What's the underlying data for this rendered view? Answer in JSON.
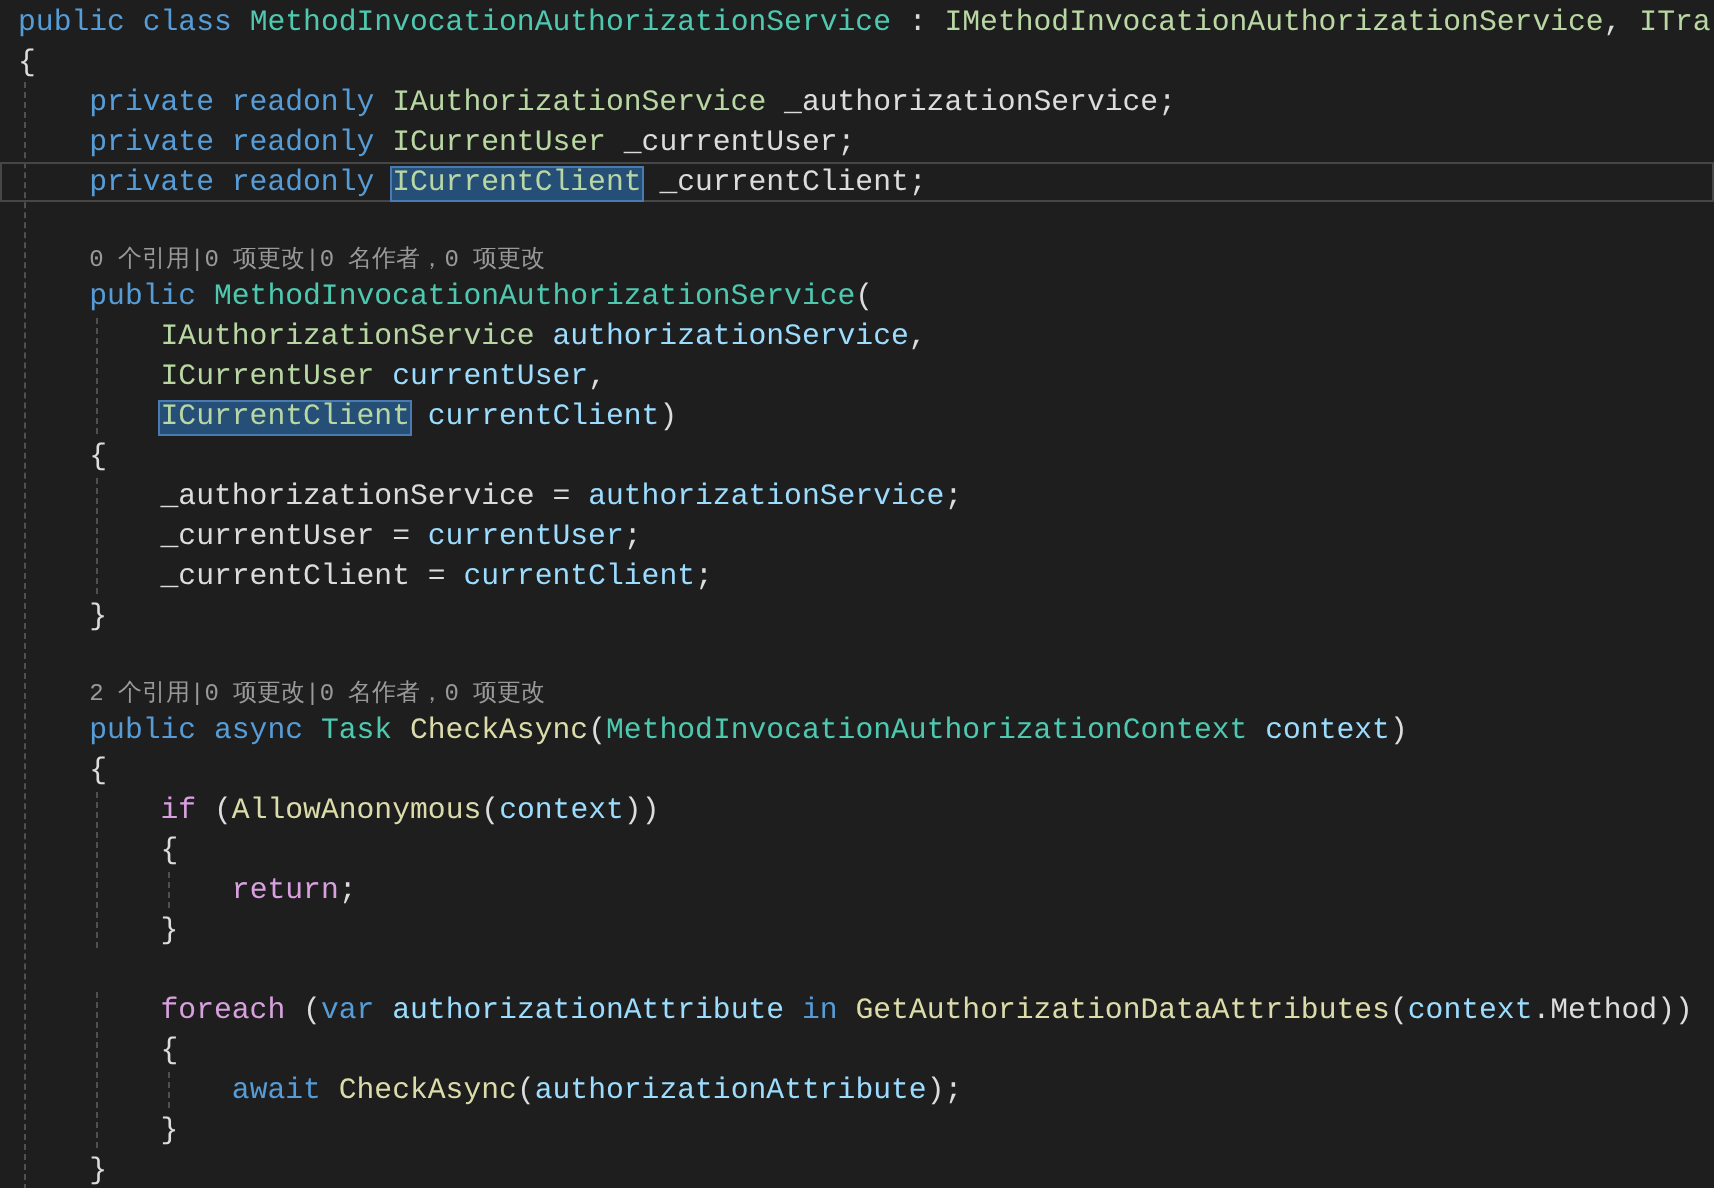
{
  "editor": {
    "lines": [
      {
        "kind": "code",
        "current": false,
        "tokens": [
          {
            "kind": "keyword",
            "text": "public class "
          },
          {
            "kind": "class",
            "text": "MethodInvocationAuthorizationService"
          },
          {
            "kind": "plain",
            "text": " : "
          },
          {
            "kind": "interface",
            "text": "IMethodInvocationAuthorizationService"
          },
          {
            "kind": "plain",
            "text": ", "
          },
          {
            "kind": "interface",
            "text": "ITra"
          }
        ]
      },
      {
        "kind": "code",
        "current": false,
        "tokens": [
          {
            "kind": "plain",
            "text": "{"
          }
        ]
      },
      {
        "kind": "code",
        "current": false,
        "tokens": [
          {
            "kind": "keyword",
            "text": "    private readonly "
          },
          {
            "kind": "interface",
            "text": "IAuthorizationService"
          },
          {
            "kind": "plain",
            "text": " _authorizationService;"
          }
        ]
      },
      {
        "kind": "code",
        "current": false,
        "tokens": [
          {
            "kind": "keyword",
            "text": "    private readonly "
          },
          {
            "kind": "interface",
            "text": "ICurrentUser"
          },
          {
            "kind": "plain",
            "text": " _currentUser;"
          }
        ]
      },
      {
        "kind": "code",
        "current": true,
        "tokens": [
          {
            "kind": "keyword",
            "text": "    private readonly "
          },
          {
            "kind": "reference",
            "text": "ICurrentClient"
          },
          {
            "kind": "plain",
            "text": " _currentClient;"
          }
        ]
      },
      {
        "kind": "blank",
        "current": false
      },
      {
        "kind": "codelens",
        "current": false,
        "text": "    0 个引用|0 项更改|0 名作者，0 项更改"
      },
      {
        "kind": "code",
        "current": false,
        "tokens": [
          {
            "kind": "keyword",
            "text": "    public "
          },
          {
            "kind": "class",
            "text": "MethodInvocationAuthorizationService"
          },
          {
            "kind": "plain",
            "text": "("
          }
        ]
      },
      {
        "kind": "code",
        "current": false,
        "tokens": [
          {
            "kind": "interface",
            "text": "        IAuthorizationService"
          },
          {
            "kind": "param",
            "text": " authorizationService"
          },
          {
            "kind": "plain",
            "text": ","
          }
        ]
      },
      {
        "kind": "code",
        "current": false,
        "tokens": [
          {
            "kind": "interface",
            "text": "        ICurrentUser"
          },
          {
            "kind": "param",
            "text": " currentUser"
          },
          {
            "kind": "plain",
            "text": ","
          }
        ]
      },
      {
        "kind": "code",
        "current": false,
        "tokens": [
          {
            "kind": "reference",
            "text": "        ICurrentClient"
          },
          {
            "kind": "param",
            "text": " currentClient"
          },
          {
            "kind": "plain",
            "text": ")"
          }
        ]
      },
      {
        "kind": "code",
        "current": false,
        "tokens": [
          {
            "kind": "plain",
            "text": "    {"
          }
        ]
      },
      {
        "kind": "code",
        "current": false,
        "tokens": [
          {
            "kind": "plain",
            "text": "        _authorizationService = "
          },
          {
            "kind": "param",
            "text": "authorizationService"
          },
          {
            "kind": "plain",
            "text": ";"
          }
        ]
      },
      {
        "kind": "code",
        "current": false,
        "tokens": [
          {
            "kind": "plain",
            "text": "        _currentUser = "
          },
          {
            "kind": "param",
            "text": "currentUser"
          },
          {
            "kind": "plain",
            "text": ";"
          }
        ]
      },
      {
        "kind": "code",
        "current": false,
        "tokens": [
          {
            "kind": "plain",
            "text": "        _currentClient = "
          },
          {
            "kind": "param",
            "text": "currentClient"
          },
          {
            "kind": "plain",
            "text": ";"
          }
        ]
      },
      {
        "kind": "code",
        "current": false,
        "tokens": [
          {
            "kind": "plain",
            "text": "    }"
          }
        ]
      },
      {
        "kind": "blank",
        "current": false
      },
      {
        "kind": "codelens",
        "current": false,
        "text": "    2 个引用|0 项更改|0 名作者，0 项更改"
      },
      {
        "kind": "code",
        "current": false,
        "tokens": [
          {
            "kind": "keyword",
            "text": "    public async "
          },
          {
            "kind": "class",
            "text": "Task"
          },
          {
            "kind": "method",
            "text": " CheckAsync"
          },
          {
            "kind": "plain",
            "text": "("
          },
          {
            "kind": "class",
            "text": "MethodInvocationAuthorizationContext"
          },
          {
            "kind": "param",
            "text": " context"
          },
          {
            "kind": "plain",
            "text": ")"
          }
        ]
      },
      {
        "kind": "code",
        "current": false,
        "tokens": [
          {
            "kind": "plain",
            "text": "    {"
          }
        ]
      },
      {
        "kind": "code",
        "current": false,
        "tokens": [
          {
            "kind": "control",
            "text": "        if"
          },
          {
            "kind": "plain",
            "text": " ("
          },
          {
            "kind": "method",
            "text": "AllowAnonymous"
          },
          {
            "kind": "plain",
            "text": "("
          },
          {
            "kind": "param",
            "text": "context"
          },
          {
            "kind": "plain",
            "text": "))"
          }
        ]
      },
      {
        "kind": "code",
        "current": false,
        "tokens": [
          {
            "kind": "plain",
            "text": "        {"
          }
        ]
      },
      {
        "kind": "code",
        "current": false,
        "tokens": [
          {
            "kind": "control",
            "text": "            return"
          },
          {
            "kind": "plain",
            "text": ";"
          }
        ]
      },
      {
        "kind": "code",
        "current": false,
        "tokens": [
          {
            "kind": "plain",
            "text": "        }"
          }
        ]
      },
      {
        "kind": "blank",
        "current": false
      },
      {
        "kind": "code",
        "current": false,
        "tokens": [
          {
            "kind": "control",
            "text": "        foreach"
          },
          {
            "kind": "plain",
            "text": " ("
          },
          {
            "kind": "keyword",
            "text": "var"
          },
          {
            "kind": "param",
            "text": " authorizationAttribute"
          },
          {
            "kind": "keyword",
            "text": " in"
          },
          {
            "kind": "method",
            "text": " GetAuthorizationDataAttributes"
          },
          {
            "kind": "plain",
            "text": "("
          },
          {
            "kind": "param",
            "text": "context"
          },
          {
            "kind": "plain",
            "text": ".Method))"
          }
        ]
      },
      {
        "kind": "code",
        "current": false,
        "tokens": [
          {
            "kind": "plain",
            "text": "        {"
          }
        ]
      },
      {
        "kind": "code",
        "current": false,
        "tokens": [
          {
            "kind": "keyword",
            "text": "            await "
          },
          {
            "kind": "method",
            "text": "CheckAsync"
          },
          {
            "kind": "plain",
            "text": "("
          },
          {
            "kind": "param",
            "text": "authorizationAttribute"
          },
          {
            "kind": "plain",
            "text": ");"
          }
        ]
      },
      {
        "kind": "code",
        "current": false,
        "tokens": [
          {
            "kind": "plain",
            "text": "        }"
          }
        ]
      },
      {
        "kind": "code",
        "current": false,
        "tokens": [
          {
            "kind": "plain",
            "text": "    }"
          }
        ]
      }
    ]
  }
}
